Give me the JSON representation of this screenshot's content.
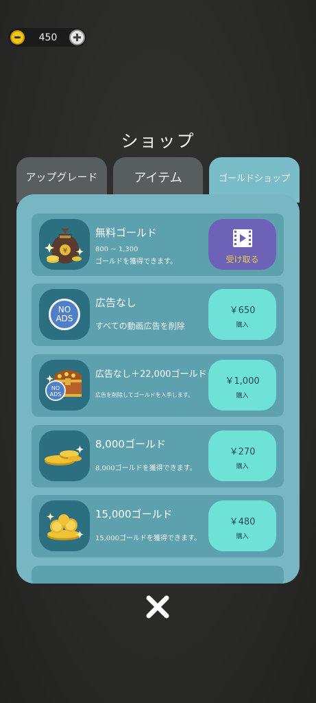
{
  "currency": {
    "amount": "450",
    "icon": "coin-icon",
    "add_icon": "plus-icon"
  },
  "title": "ショップ",
  "tabs": [
    {
      "label": "アップグレード"
    },
    {
      "label": "アイテム"
    },
    {
      "label": "ゴールドショップ"
    }
  ],
  "items": [
    {
      "title": "無料ゴールド",
      "desc_line1": "800 ~ 1,300",
      "desc_line2": "ゴールドを獲得できます。",
      "button": "受け取る",
      "icon": "money-bag-icon"
    },
    {
      "title": "広告なし",
      "desc": "すべての動画広告を削除",
      "price": "￥650",
      "buy": "購入",
      "badge": [
        "NO",
        "ADS"
      ]
    },
    {
      "title": "広告なし＋22,000ゴールド",
      "desc": "広告を削除してゴールドを入手します。",
      "price": "￥1,000",
      "buy": "購入",
      "badge": [
        "NO",
        "ADS"
      ]
    },
    {
      "title": "8,000ゴールド",
      "desc": "8,000ゴールドを獲得できます。",
      "price": "￥270",
      "buy": "購入"
    },
    {
      "title": "15,000ゴールド",
      "desc": "15,000ゴールドを獲得できます。",
      "price": "￥480",
      "buy": "購入"
    }
  ],
  "colors": {
    "panel": "#79b6c3",
    "row": "#5da0ae",
    "icon_bg": "#2b6f80",
    "buy_button": "#6fe2d8",
    "ad_button": "#6e62b8",
    "ad_label": "#e6cf49"
  }
}
